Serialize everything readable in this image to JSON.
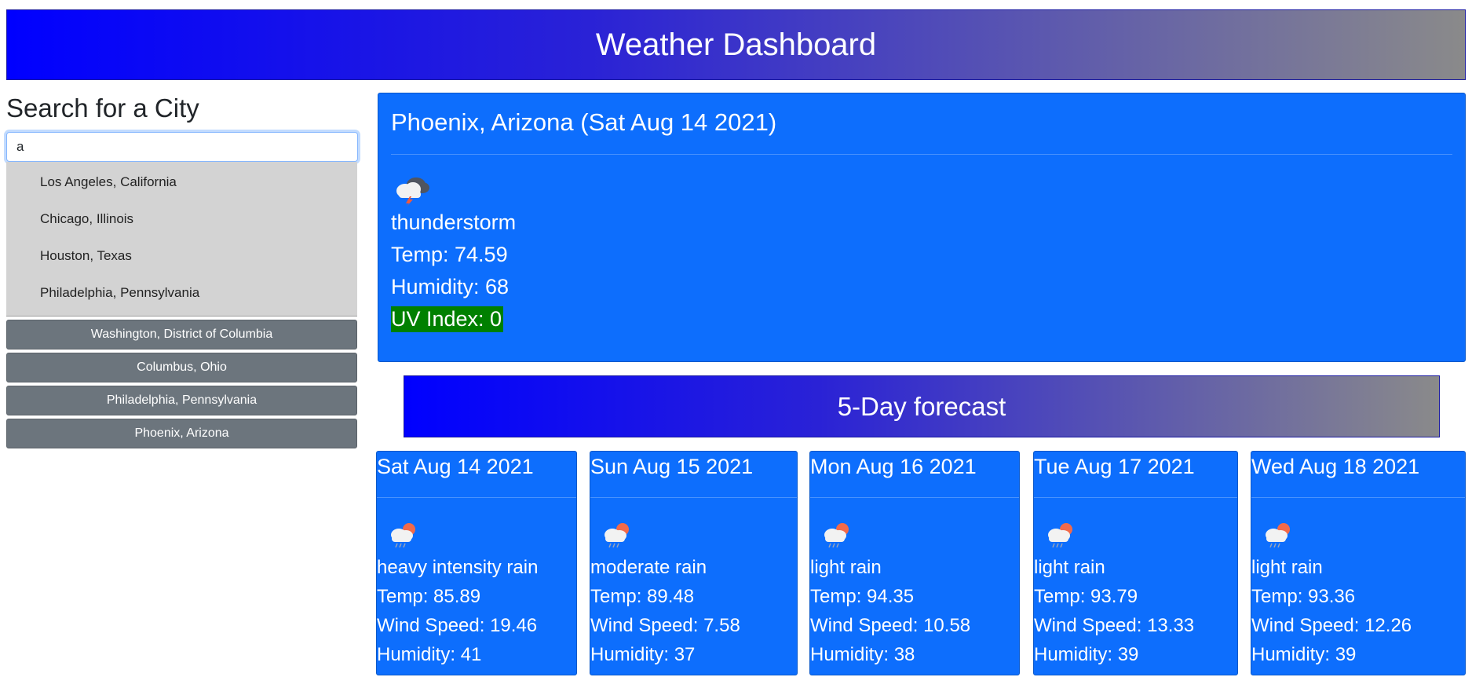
{
  "header": {
    "title": "Weather Dashboard"
  },
  "sidebar": {
    "title": "Search for a City",
    "search_value": "a",
    "suggestions": [
      "Los Angeles, California",
      "Chicago, Illinois",
      "Houston, Texas",
      "Philadelphia, Pennsylvania"
    ],
    "history": [
      "Washington, District of Columbia",
      "Columbus, Ohio",
      "Philadelphia, Pennsylvania",
      "Phoenix, Arizona"
    ]
  },
  "current": {
    "title": "Phoenix, Arizona (Sat Aug 14 2021)",
    "icon": "thunderstorm-icon",
    "description": "thunderstorm",
    "temp": "Temp: 74.59",
    "humidity": "Humidity: 68",
    "uv": "UV Index: 0",
    "uv_color": "#008000"
  },
  "forecast": {
    "title": "5-Day forecast",
    "days": [
      {
        "date": "Sat Aug 14 2021",
        "icon": "rain-icon",
        "description": "heavy intensity rain",
        "temp": "Temp: 85.89",
        "wind": "Wind Speed: 19.46",
        "humidity": "Humidity: 41"
      },
      {
        "date": "Sun Aug 15 2021",
        "icon": "rain-icon",
        "description": "moderate rain",
        "temp": "Temp: 89.48",
        "wind": "Wind Speed: 7.58",
        "humidity": "Humidity: 37"
      },
      {
        "date": "Mon Aug 16 2021",
        "icon": "rain-icon",
        "description": "light rain",
        "temp": "Temp: 94.35",
        "wind": "Wind Speed: 10.58",
        "humidity": "Humidity: 38"
      },
      {
        "date": "Tue Aug 17 2021",
        "icon": "rain-icon",
        "description": "light rain",
        "temp": "Temp: 93.79",
        "wind": "Wind Speed: 13.33",
        "humidity": "Humidity: 39"
      },
      {
        "date": "Wed Aug 18 2021",
        "icon": "rain-icon",
        "description": "light rain",
        "temp": "Temp: 93.36",
        "wind": "Wind Speed: 12.26",
        "humidity": "Humidity: 39"
      }
    ]
  },
  "colors": {
    "card_blue": "#0d6efd",
    "history_gray": "#6c757d",
    "autocomplete_bg": "#d3d3d3"
  }
}
